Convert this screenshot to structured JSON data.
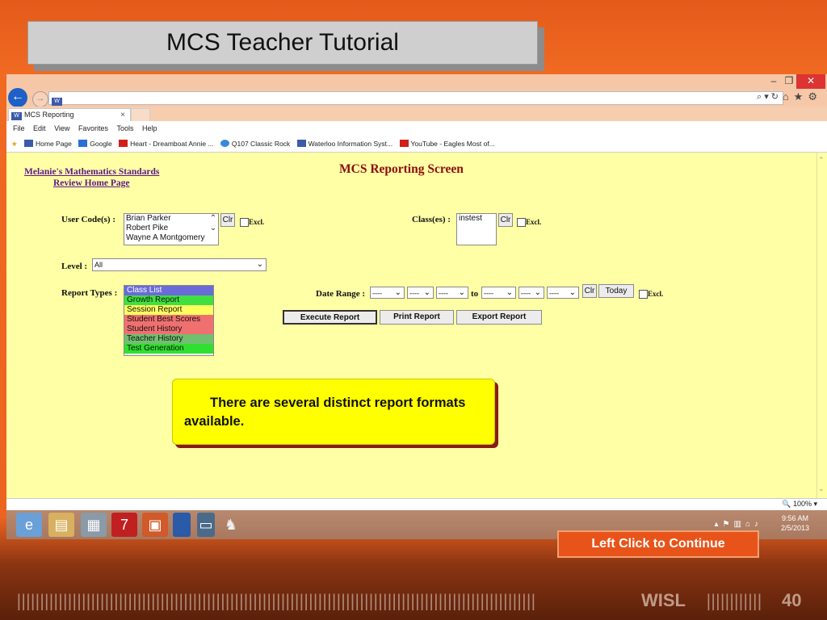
{
  "slide": {
    "title": "MCS Teacher Tutorial",
    "continue_label": "Left Click to Continue",
    "brand": "WISL",
    "page_number": "40",
    "callout_text": "There are several distinct report formats available."
  },
  "browser": {
    "address_text": "",
    "tab_label": "MCS Reporting",
    "tab_close": "×",
    "menu": [
      "File",
      "Edit",
      "View",
      "Favorites",
      "Tools",
      "Help"
    ],
    "favorites": [
      {
        "label": "Home Page",
        "icon": "site-icon",
        "color": "#3b5aa8"
      },
      {
        "label": "Google",
        "icon": "google-icon",
        "color": "#2a6fd8"
      },
      {
        "label": "Heart - Dreamboat Annie ...",
        "icon": "youtube-icon",
        "color": "#d0201a"
      },
      {
        "label": "Q107 Classic Rock",
        "icon": "ie-icon",
        "color": "#3a8ad8"
      },
      {
        "label": "Waterloo Information Syst...",
        "icon": "site-icon",
        "color": "#3b5aa8"
      },
      {
        "label": "YouTube - Eagles Most of...",
        "icon": "youtube-icon",
        "color": "#d0201a"
      }
    ],
    "zoom": "100%"
  },
  "page": {
    "link1": "Melanie's Mathematics Standards",
    "link2": "Review Home Page",
    "heading": "MCS Reporting Screen",
    "user_codes_label": "User Code(s) :",
    "users": [
      "Brian Parker",
      "Robert Pike",
      "Wayne A Montgomery"
    ],
    "classes_label": "Class(es) :",
    "classes": [
      "instest"
    ],
    "clr": "Clr",
    "excl": "Excl.",
    "level_label": "Level :",
    "level_value": "All",
    "report_types_label": "Report Types :",
    "report_types": [
      {
        "label": "Class List",
        "color": "#6a6ad8"
      },
      {
        "label": "Growth Report",
        "color": "#40e040"
      },
      {
        "label": "Session Report",
        "color": "#ffff60"
      },
      {
        "label": "Student Best Scores",
        "color": "#f07070"
      },
      {
        "label": "Student History",
        "color": "#f07070"
      },
      {
        "label": "Teacher History",
        "color": "#70c070"
      },
      {
        "label": "Test Generation",
        "color": "#30e030"
      }
    ],
    "date_range_label": "Date Range :",
    "date_placeholder": "----",
    "to": "to",
    "today": "Today",
    "execute": "Execute Report",
    "print": "Print Report",
    "export": "Export Report"
  },
  "taskbar": {
    "time": "9:56 AM",
    "date": "2/5/2013"
  }
}
